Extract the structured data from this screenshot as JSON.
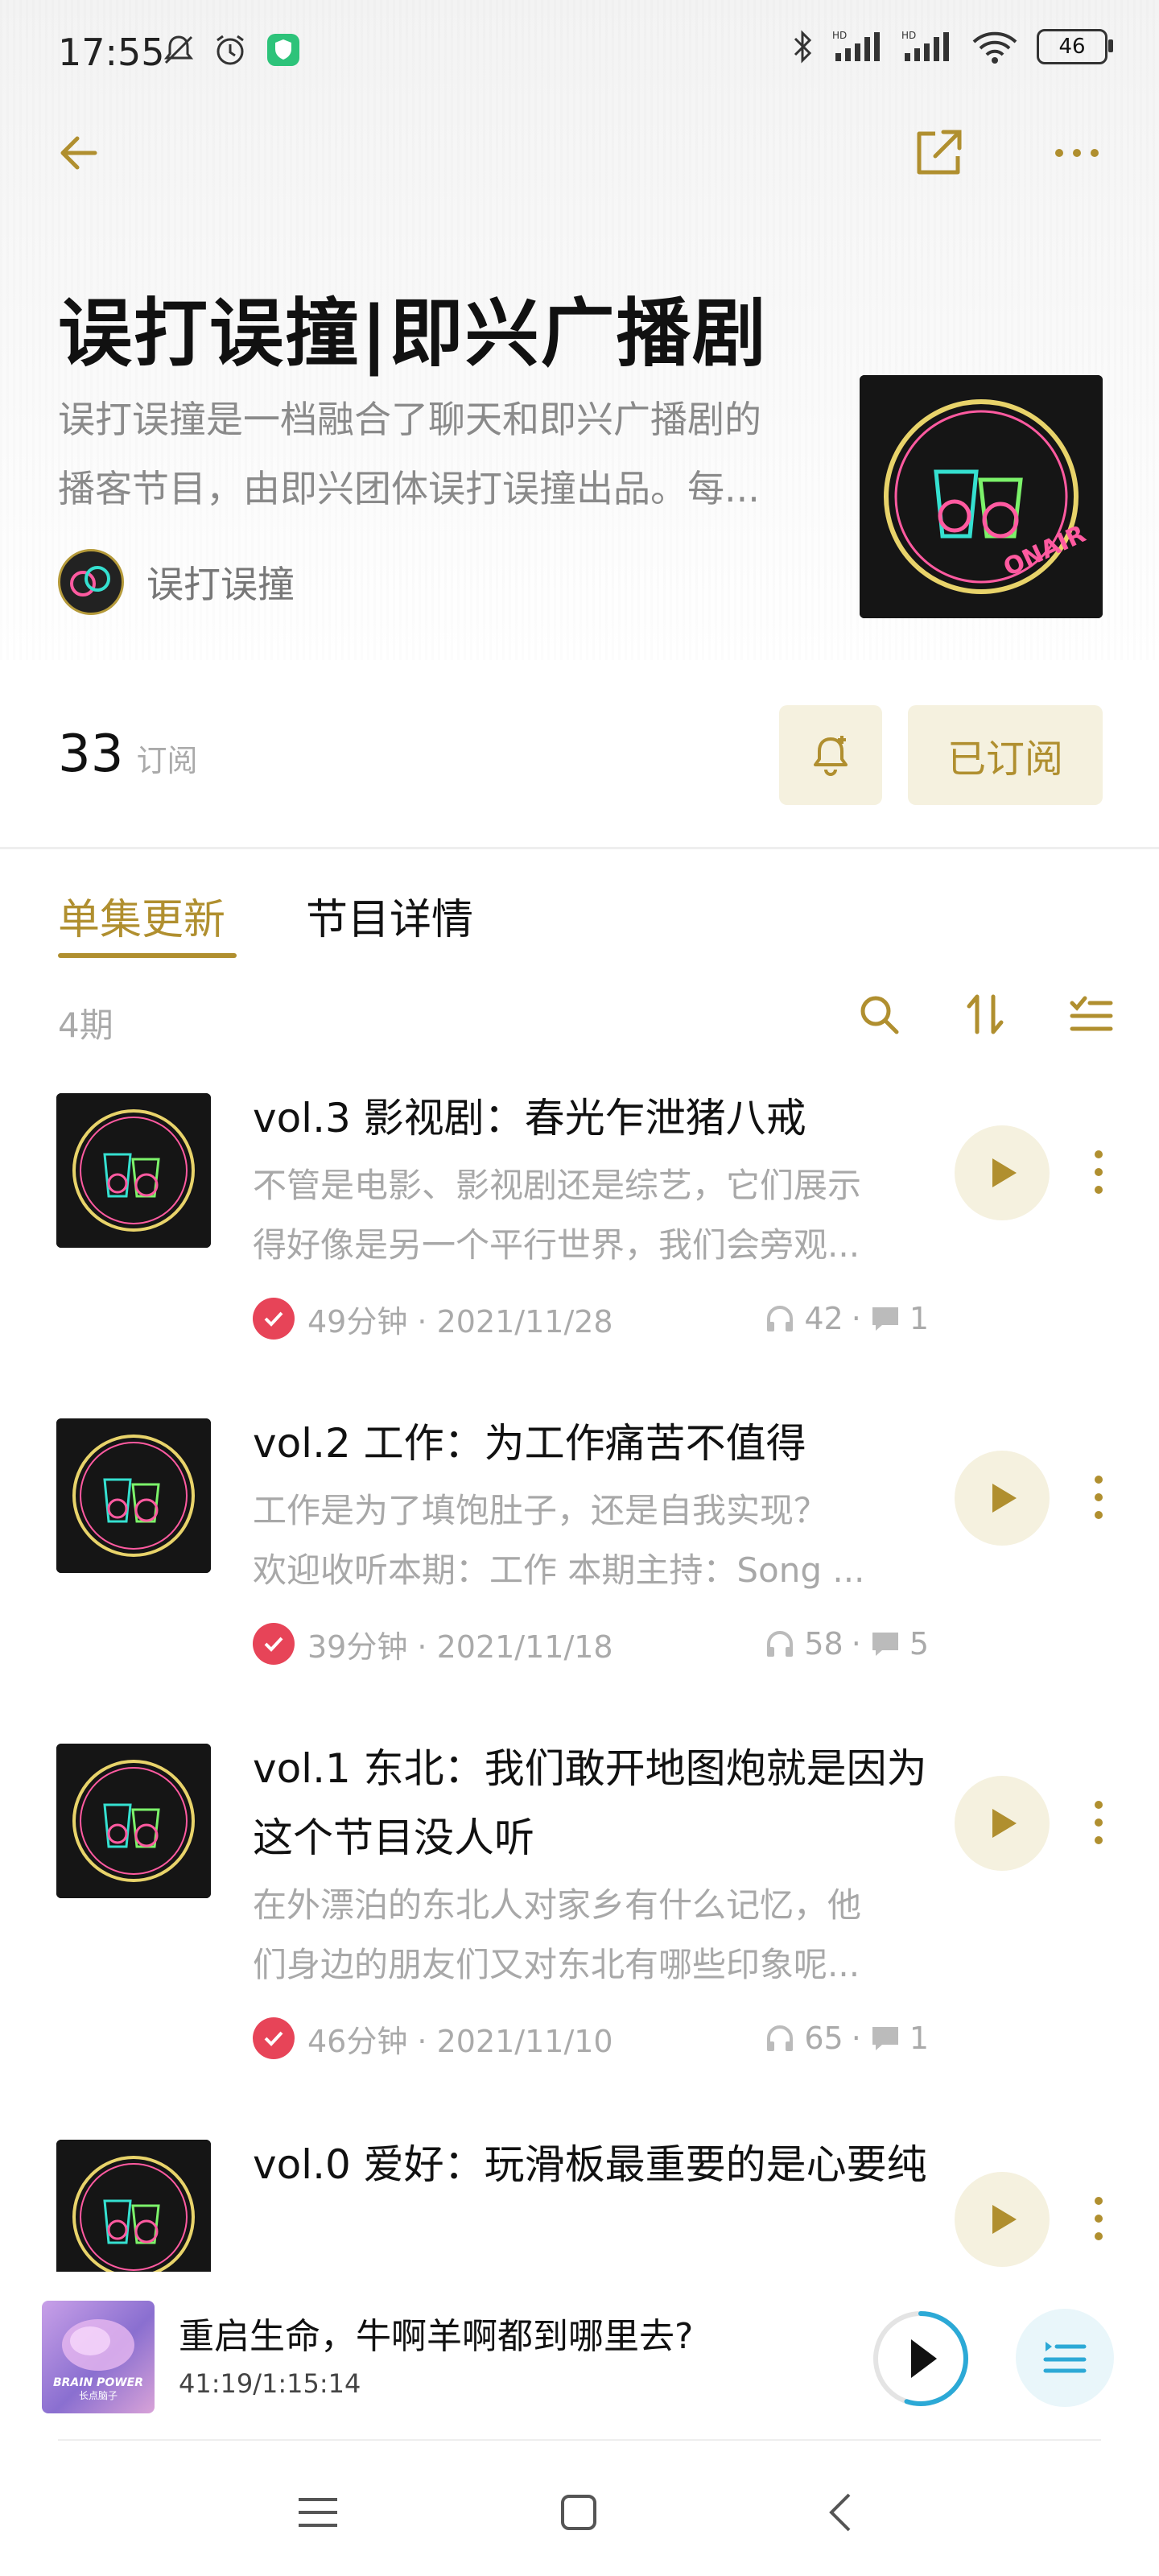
{
  "status_bar": {
    "time": "17:55",
    "battery": "46"
  },
  "header": {
    "title": "误打误撞|即兴广播剧",
    "description_lines": [
      "误打误撞是一档融合了聊天和即兴广播剧的",
      "播客节目，由即兴团体误打误撞出品。每..."
    ],
    "author": "误打误撞",
    "subscriber_count": "33",
    "subscriber_label": "订阅",
    "subscribe_button": "已订阅",
    "cover_text": "ONAIR"
  },
  "tabs": [
    {
      "label": "单集更新",
      "active": true
    },
    {
      "label": "节目详情",
      "active": false
    }
  ],
  "episode_count": "4期",
  "episodes": [
    {
      "title": "vol.3 影视剧：春光乍泄猪八戒",
      "desc": [
        "不管是电影、影视剧还是综艺，它们展示",
        "得好像是另一个平行世界，我们会旁观..."
      ],
      "meta": "49分钟 · 2021/11/28",
      "listens": "42",
      "comments": "1"
    },
    {
      "title": "vol.2 工作：为工作痛苦不值得",
      "desc": [
        "工作是为了填饱肚子，还是自我实现？",
        "欢迎收听本期：工作 本期主持：Song ..."
      ],
      "meta": "39分钟 · 2021/11/18",
      "listens": "58",
      "comments": "5"
    },
    {
      "title": "vol.1 东北：我们敢开地图炮就是因为这个节目没人听",
      "desc": [
        "在外漂泊的东北人对家乡有什么记忆，他",
        "们身边的朋友们又对东北有哪些印象呢..."
      ],
      "meta": "46分钟 · 2021/11/10",
      "listens": "65",
      "comments": "1"
    },
    {
      "title": "vol.0 爱好：玩滑板最重要的是心要纯"
    }
  ],
  "player": {
    "title": "重启生命，牛啊羊啊都到哪里去?",
    "time": "41:19/1:15:14",
    "cover_line1": "BRAIN POWER",
    "cover_line2": "长点脑子",
    "progress": 0.55
  },
  "colors": {
    "accent": "#b08f2f",
    "chip_bg": "#f5f1df",
    "check": "#e74458",
    "player_ring": "#2ca9d6"
  }
}
